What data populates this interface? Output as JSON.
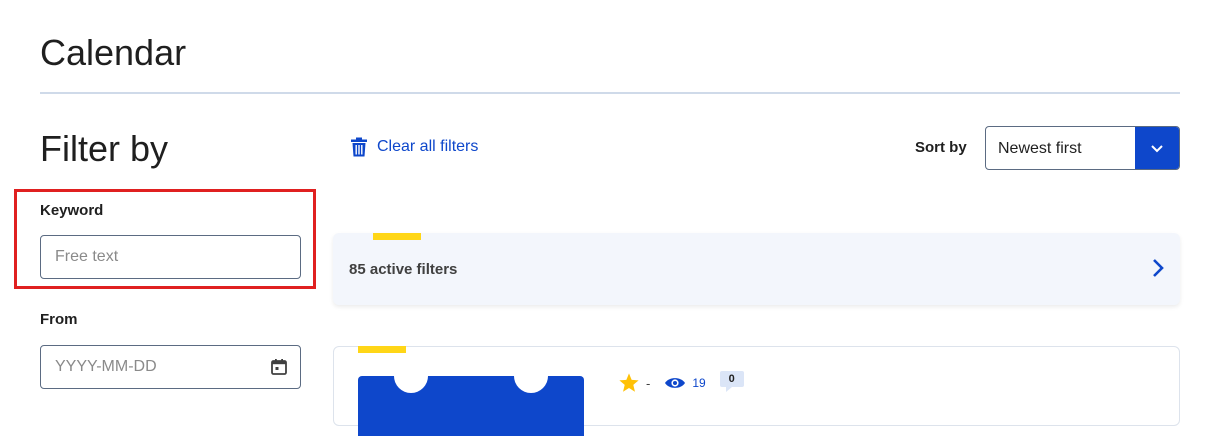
{
  "page": {
    "title": "Calendar"
  },
  "filters": {
    "heading": "Filter by",
    "keyword": {
      "label": "Keyword",
      "placeholder": "Free text"
    },
    "from": {
      "label": "From",
      "placeholder": "YYYY-MM-DD"
    }
  },
  "toolbar": {
    "clear_filters_label": "Clear all filters",
    "sort_label": "Sort by",
    "sort_value": "Newest first"
  },
  "active_filters": {
    "text": "85 active filters"
  },
  "result": {
    "rating": "-",
    "views": "19",
    "comments": "0"
  },
  "colors": {
    "accent_blue": "#0e47cb",
    "accent_yellow": "#ffd617",
    "highlight_red": "#e02020"
  },
  "icons": [
    "trash-icon",
    "chevron-down-icon",
    "calendar-icon",
    "chevron-right-icon",
    "star-icon",
    "eye-icon"
  ]
}
